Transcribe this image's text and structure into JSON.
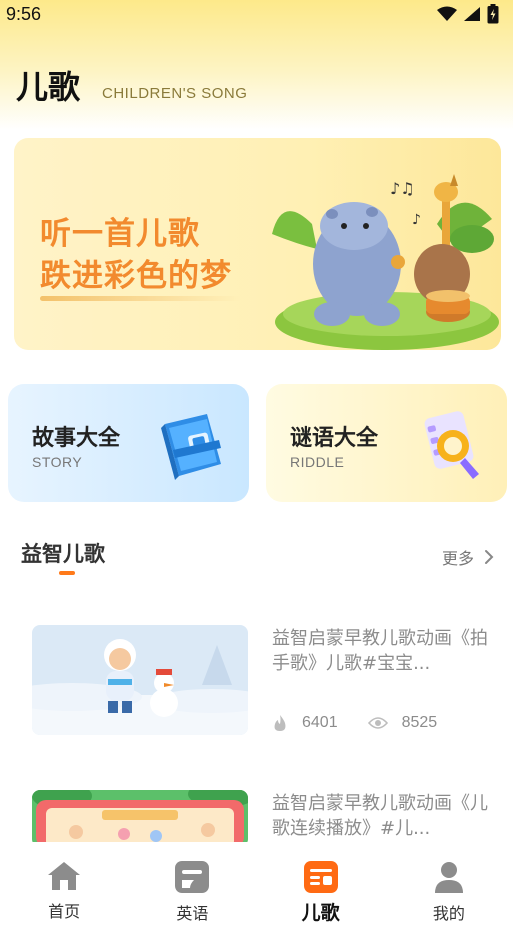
{
  "status_bar": {
    "time": "9:56"
  },
  "header": {
    "title": "儿歌",
    "subtitle": "CHILDREN'S SONG"
  },
  "banner": {
    "line1": "听一首儿歌",
    "line2": "跌进彩色的梦"
  },
  "cards": [
    {
      "title": "故事大全",
      "subtitle": "STORY"
    },
    {
      "title": "谜语大全",
      "subtitle": "RIDDLE"
    }
  ],
  "section": {
    "title": "益智儿歌",
    "more_label": "更多"
  },
  "videos": [
    {
      "title": "益智启蒙早教儿歌动画《拍手歌》儿歌#宝宝...",
      "likes": "6401",
      "views": "8525"
    },
    {
      "title": "益智启蒙早教儿歌动画《儿歌连续播放》#儿..."
    }
  ],
  "tabs": [
    {
      "label": "首页"
    },
    {
      "label": "英语"
    },
    {
      "label": "儿歌"
    },
    {
      "label": "我的"
    }
  ],
  "colors": {
    "accent": "#ff7a1a",
    "banner_text": "#f28a2e"
  },
  "icons": [
    "wifi-icon",
    "signal-icon",
    "battery-icon",
    "flame-icon",
    "eye-icon",
    "chevron-right-icon",
    "home-icon",
    "english-icon",
    "song-icon",
    "profile-icon"
  ]
}
